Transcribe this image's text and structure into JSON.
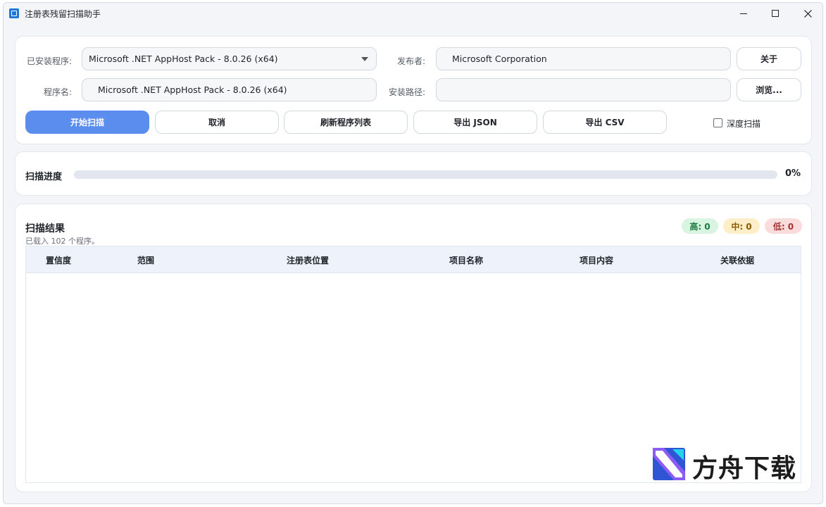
{
  "window": {
    "title": "注册表残留扫描助手"
  },
  "form": {
    "installed_label": "已安装程序:",
    "installed_value": "Microsoft .NET AppHost Pack - 8.0.26 (x64)",
    "publisher_label": "发布者:",
    "publisher_value": "Microsoft Corporation",
    "program_label": "程序名:",
    "program_value": "Microsoft .NET AppHost Pack - 8.0.26 (x64)",
    "path_label": "安装路径:",
    "path_value": "",
    "about_button": "关于",
    "browse_button": "浏览..."
  },
  "actions": {
    "start": "开始扫描",
    "cancel": "取消",
    "refresh": "刷新程序列表",
    "export_json": "导出 JSON",
    "export_csv": "导出 CSV",
    "deep_scan": "深度扫描",
    "deep_scan_checked": false
  },
  "progress": {
    "label": "扫描进度",
    "percent": 0,
    "percent_text": "0%"
  },
  "results": {
    "title": "扫描结果",
    "subtitle": "已载入 102 个程序。",
    "badges": {
      "high": "高: 0",
      "mid": "中: 0",
      "low": "低: 0"
    },
    "columns": [
      "置信度",
      "范围",
      "注册表位置",
      "项目名称",
      "项目内容",
      "关联依据"
    ],
    "rows": []
  },
  "watermark": {
    "text": "方舟下载"
  },
  "colors": {
    "accent": "#5b8def",
    "badge_high_bg": "#d9f5e2",
    "badge_mid_bg": "#fdeec8",
    "badge_low_bg": "#fbdcdc"
  }
}
